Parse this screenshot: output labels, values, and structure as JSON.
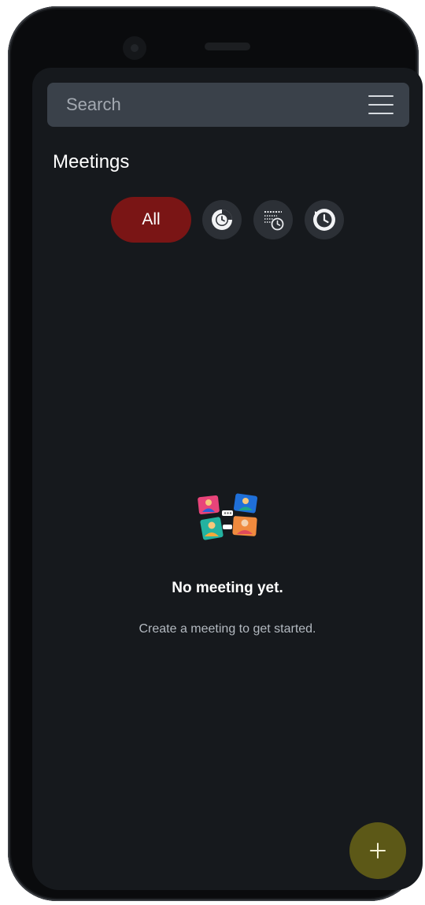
{
  "search": {
    "placeholder": "Search"
  },
  "page": {
    "title": "Meetings"
  },
  "filters": {
    "all_label": "All",
    "items": [
      {
        "icon": "pie-clock-icon"
      },
      {
        "icon": "calendar-clock-icon"
      },
      {
        "icon": "history-icon"
      }
    ]
  },
  "empty_state": {
    "illustration": "meeting-participants-icon",
    "title": "No meeting yet.",
    "subtitle": "Create a meeting to get started."
  },
  "fab": {
    "icon": "plus-icon"
  },
  "colors": {
    "screen_bg": "#16191d",
    "search_bg": "#3a414a",
    "chip_active": "#7a1515",
    "chip_bg": "#2c3036",
    "fab_bg": "#5c5817"
  }
}
